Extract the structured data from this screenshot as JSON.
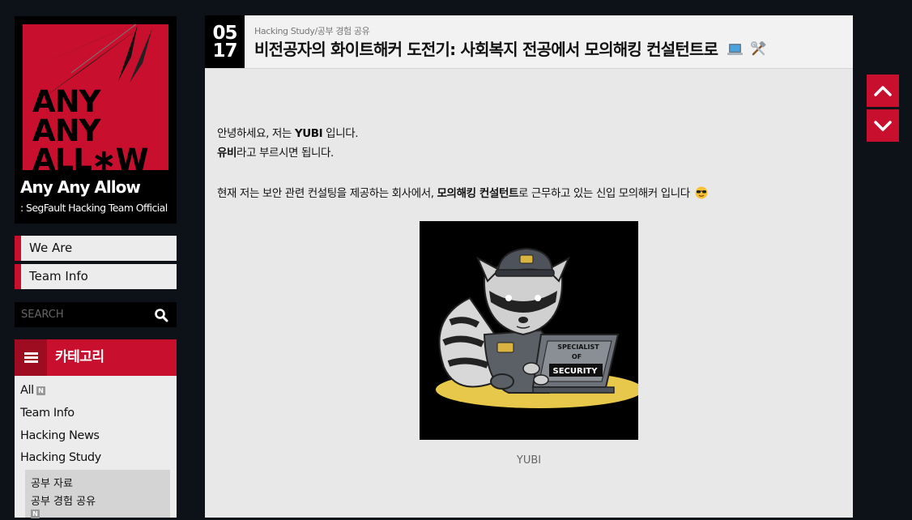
{
  "blog": {
    "logo_lines": [
      "ANY",
      "ANY",
      "ALL∗W"
    ],
    "title": "Any Any Allow",
    "subtitle": ": SegFault Hacking Team Official"
  },
  "nav": [
    {
      "label": "We Are"
    },
    {
      "label": "Team Info"
    }
  ],
  "search": {
    "placeholder": "SEARCH"
  },
  "category": {
    "title": "카테고리",
    "items": [
      {
        "label": "All",
        "new_badge": "N"
      },
      {
        "label": "Team Info"
      },
      {
        "label": "Hacking News"
      },
      {
        "label": "Hacking Study"
      }
    ],
    "subitems": [
      {
        "label": "공부 자료"
      },
      {
        "label": "공부 경험 공유",
        "new_badge": "N"
      }
    ]
  },
  "post": {
    "month": "05",
    "day": "17",
    "breadcrumb": "Hacking Study/공부 경험 공유",
    "title": "비전공자의 화이트해커 도전기: 사회복지 전공에서 모의해킹 컨설턴트로",
    "title_emojis": [
      "laptop-icon",
      "tools-icon"
    ],
    "greeting_1_prefix": "안녕하세요, 저는 ",
    "greeting_1_name": "YUBI",
    "greeting_1_suffix": " 입니다.",
    "greeting_2_name": "유비",
    "greeting_2_suffix": "라고 부르시면 됩니다.",
    "job_prefix": "현재 저는 보안 관련 컨설팅을 제공하는 회사에서, ",
    "job_bold": "모의해킹 컨설턴트",
    "job_suffix": "로 근무하고 있는 신입 모의해커 입니다",
    "image_caption": "YUBI",
    "image_laptop_text": [
      "SPECIALIST",
      "OF",
      "SECURITY"
    ]
  },
  "colors": {
    "accent": "#c8102e",
    "background": "#0d1219",
    "panel": "#e8e8e8"
  }
}
